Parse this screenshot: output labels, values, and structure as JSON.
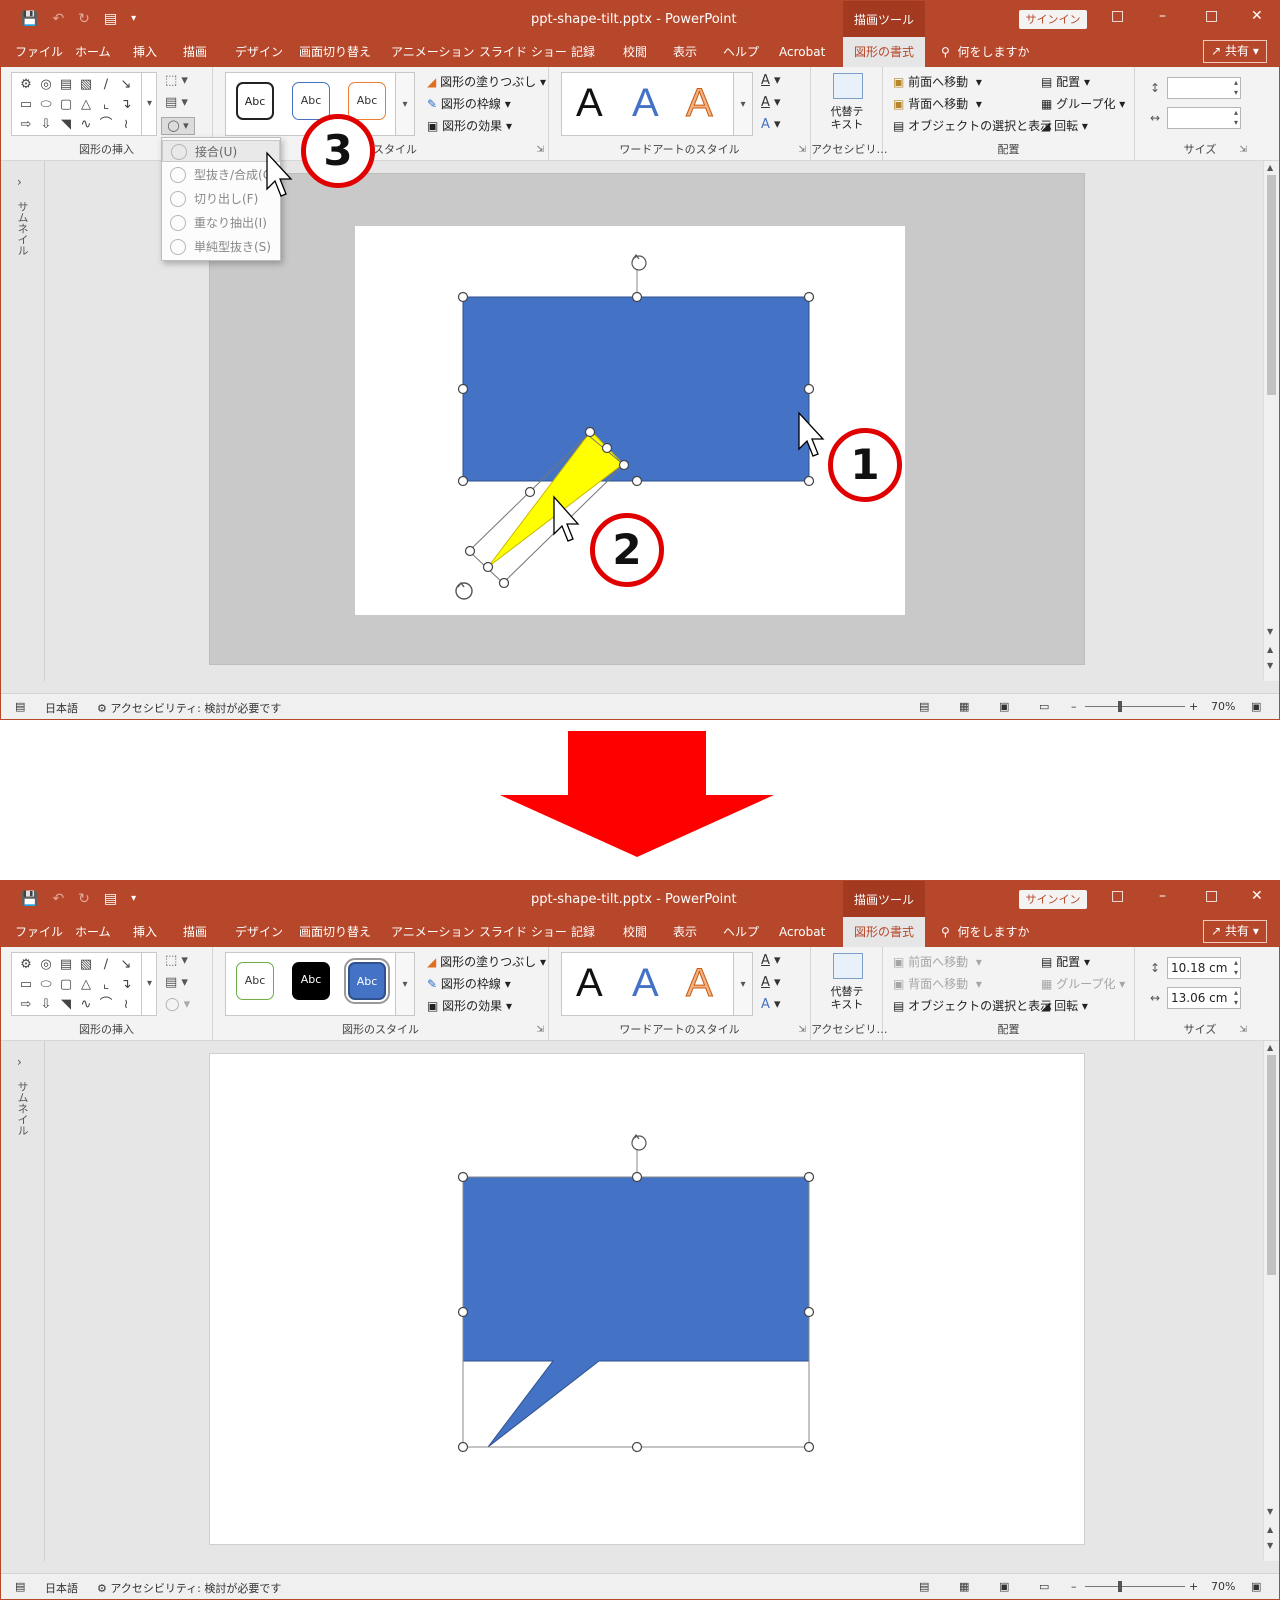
{
  "app": {
    "document_title": "ppt-shape-tilt.pptx  -  PowerPoint",
    "context_tool": "描画ツール",
    "signin": "サインイン",
    "tell_me": "何をしますか",
    "share": "共有"
  },
  "tabs": [
    {
      "label": "ファイル"
    },
    {
      "label": "ホーム"
    },
    {
      "label": "挿入"
    },
    {
      "label": "描画"
    },
    {
      "label": "デザイン"
    },
    {
      "label": "画面切り替え"
    },
    {
      "label": "アニメーション"
    },
    {
      "label": "スライド ショー"
    },
    {
      "label": "記録"
    },
    {
      "label": "校閲"
    },
    {
      "label": "表示"
    },
    {
      "label": "ヘルプ"
    },
    {
      "label": "Acrobat"
    },
    {
      "label": "図形の書式",
      "active": true
    }
  ],
  "ribbon": {
    "groups": {
      "insert_shapes": "図形の挿入",
      "shape_styles": "図形のスタイル",
      "shape_styles_partial": "スタイル",
      "wordart_styles": "ワードアートのスタイル",
      "accessibility": "アクセシビリ…",
      "arrange": "配置",
      "size": "サイズ"
    },
    "shape_fill": "図形の塗りつぶし",
    "shape_outline": "図形の枠線",
    "shape_effects": "図形の効果",
    "style_sample": "Abc",
    "wordart_sample": "A",
    "alt_text": "代替テ\nキスト",
    "bring_forward": "前面へ移動",
    "send_backward": "背面へ移動",
    "selection_pane": "オブジェクトの選択と表示",
    "align": "配置",
    "group": "グループ化",
    "rotate": "回転"
  },
  "merge_menu": {
    "items": [
      "接合(U)",
      "型抜き/合成(C)",
      "切り出し(F)",
      "重なり抽出(I)",
      "単純型抜き(S)"
    ],
    "highlighted": "接合(U)"
  },
  "size_after": {
    "height": "10.18 cm",
    "width": "13.06 cm"
  },
  "thumbnails_label": "サムネイル",
  "status": {
    "language": "日本語",
    "accessibility": "アクセシビリティ: 検討が必要です",
    "zoom": "70%"
  },
  "steps": {
    "one": "1",
    "two": "2",
    "three": "3"
  },
  "colors": {
    "title_bar": "#b7472a",
    "rect_fill": "#4472c4",
    "triangle_fill": "#ffff00",
    "badge_ring": "#e00000",
    "transition_arrow": "#ff0000"
  }
}
